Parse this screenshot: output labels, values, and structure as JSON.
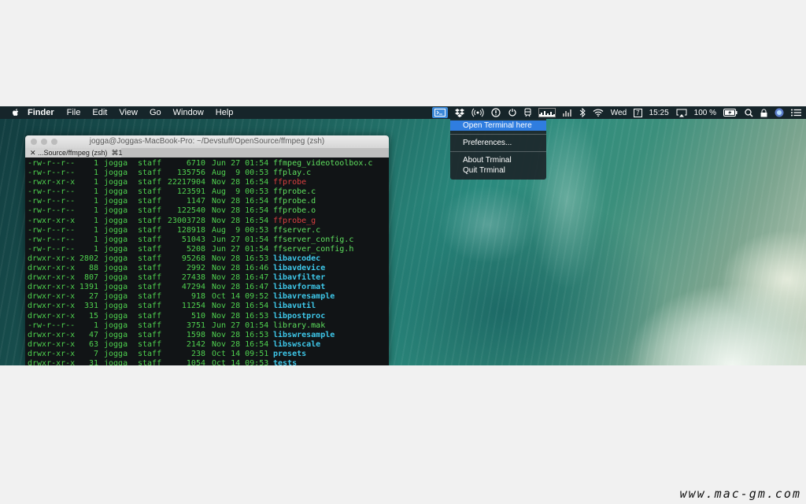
{
  "menubar": {
    "app_menu": "Finder",
    "items": [
      "File",
      "Edit",
      "View",
      "Go",
      "Window",
      "Help"
    ],
    "status": {
      "day": "Wed",
      "date_badge": "7",
      "time": "15:25",
      "battery_percent": "100 %"
    }
  },
  "dropdown": {
    "items": [
      "Open Terminal here",
      "Preferences...",
      "About Trminal",
      "Quit Trminal"
    ]
  },
  "terminal": {
    "window_title": "jogga@Joggas-MacBook-Pro: ~/Devstuff/OpenSource/ffmpeg (zsh)",
    "tab_label": "...Source/ffmpeg (zsh)",
    "tab_shortcut": "⌘1",
    "rows": [
      {
        "perm": "-rw-r--r--",
        "links": "1",
        "user": "jogga",
        "group": "staff",
        "size": "6710",
        "date": "Jun 27 01:54",
        "name": "ffmpeg_videotoolbox.c",
        "kind": "file"
      },
      {
        "perm": "-rw-r--r--",
        "links": "1",
        "user": "jogga",
        "group": "staff",
        "size": "135756",
        "date": "Aug  9 00:53",
        "name": "ffplay.c",
        "kind": "file"
      },
      {
        "perm": "-rwxr-xr-x",
        "links": "1",
        "user": "jogga",
        "group": "staff",
        "size": "22217904",
        "date": "Nov 28 16:54",
        "name": "ffprobe",
        "kind": "exec"
      },
      {
        "perm": "-rw-r--r--",
        "links": "1",
        "user": "jogga",
        "group": "staff",
        "size": "123591",
        "date": "Aug  9 00:53",
        "name": "ffprobe.c",
        "kind": "file"
      },
      {
        "perm": "-rw-r--r--",
        "links": "1",
        "user": "jogga",
        "group": "staff",
        "size": "1147",
        "date": "Nov 28 16:54",
        "name": "ffprobe.d",
        "kind": "file"
      },
      {
        "perm": "-rw-r--r--",
        "links": "1",
        "user": "jogga",
        "group": "staff",
        "size": "122540",
        "date": "Nov 28 16:54",
        "name": "ffprobe.o",
        "kind": "file"
      },
      {
        "perm": "-rwxr-xr-x",
        "links": "1",
        "user": "jogga",
        "group": "staff",
        "size": "23003728",
        "date": "Nov 28 16:54",
        "name": "ffprobe_g",
        "kind": "exec"
      },
      {
        "perm": "-rw-r--r--",
        "links": "1",
        "user": "jogga",
        "group": "staff",
        "size": "128918",
        "date": "Aug  9 00:53",
        "name": "ffserver.c",
        "kind": "file"
      },
      {
        "perm": "-rw-r--r--",
        "links": "1",
        "user": "jogga",
        "group": "staff",
        "size": "51043",
        "date": "Jun 27 01:54",
        "name": "ffserver_config.c",
        "kind": "file"
      },
      {
        "perm": "-rw-r--r--",
        "links": "1",
        "user": "jogga",
        "group": "staff",
        "size": "5208",
        "date": "Jun 27 01:54",
        "name": "ffserver_config.h",
        "kind": "file"
      },
      {
        "perm": "drwxr-xr-x",
        "links": "2802",
        "user": "jogga",
        "group": "staff",
        "size": "95268",
        "date": "Nov 28 16:53",
        "name": "libavcodec",
        "kind": "dir"
      },
      {
        "perm": "drwxr-xr-x",
        "links": "88",
        "user": "jogga",
        "group": "staff",
        "size": "2992",
        "date": "Nov 28 16:46",
        "name": "libavdevice",
        "kind": "dir"
      },
      {
        "perm": "drwxr-xr-x",
        "links": "807",
        "user": "jogga",
        "group": "staff",
        "size": "27438",
        "date": "Nov 28 16:47",
        "name": "libavfilter",
        "kind": "dir"
      },
      {
        "perm": "drwxr-xr-x",
        "links": "1391",
        "user": "jogga",
        "group": "staff",
        "size": "47294",
        "date": "Nov 28 16:47",
        "name": "libavformat",
        "kind": "dir"
      },
      {
        "perm": "drwxr-xr-x",
        "links": "27",
        "user": "jogga",
        "group": "staff",
        "size": "918",
        "date": "Oct 14 09:52",
        "name": "libavresample",
        "kind": "dir"
      },
      {
        "perm": "drwxr-xr-x",
        "links": "331",
        "user": "jogga",
        "group": "staff",
        "size": "11254",
        "date": "Nov 28 16:54",
        "name": "libavutil",
        "kind": "dir"
      },
      {
        "perm": "drwxr-xr-x",
        "links": "15",
        "user": "jogga",
        "group": "staff",
        "size": "510",
        "date": "Nov 28 16:53",
        "name": "libpostproc",
        "kind": "dir"
      },
      {
        "perm": "-rw-r--r--",
        "links": "1",
        "user": "jogga",
        "group": "staff",
        "size": "3751",
        "date": "Jun 27 01:54",
        "name": "library.mak",
        "kind": "file"
      },
      {
        "perm": "drwxr-xr-x",
        "links": "47",
        "user": "jogga",
        "group": "staff",
        "size": "1598",
        "date": "Nov 28 16:53",
        "name": "libswresample",
        "kind": "dir"
      },
      {
        "perm": "drwxr-xr-x",
        "links": "63",
        "user": "jogga",
        "group": "staff",
        "size": "2142",
        "date": "Nov 28 16:54",
        "name": "libswscale",
        "kind": "dir"
      },
      {
        "perm": "drwxr-xr-x",
        "links": "7",
        "user": "jogga",
        "group": "staff",
        "size": "238",
        "date": "Oct 14 09:51",
        "name": "presets",
        "kind": "dir"
      },
      {
        "perm": "drwxr-xr-x",
        "links": "31",
        "user": "jogga",
        "group": "staff",
        "size": "1054",
        "date": "Oct 14 09:53",
        "name": "tests",
        "kind": "dir"
      }
    ]
  },
  "watermark": "www.mac-gm.com",
  "colors": {
    "menu_highlight": "#2f7de0",
    "terminal_text": "#4fd14f",
    "exec_name": "#d94040",
    "dir_name": "#3ec8ea"
  }
}
